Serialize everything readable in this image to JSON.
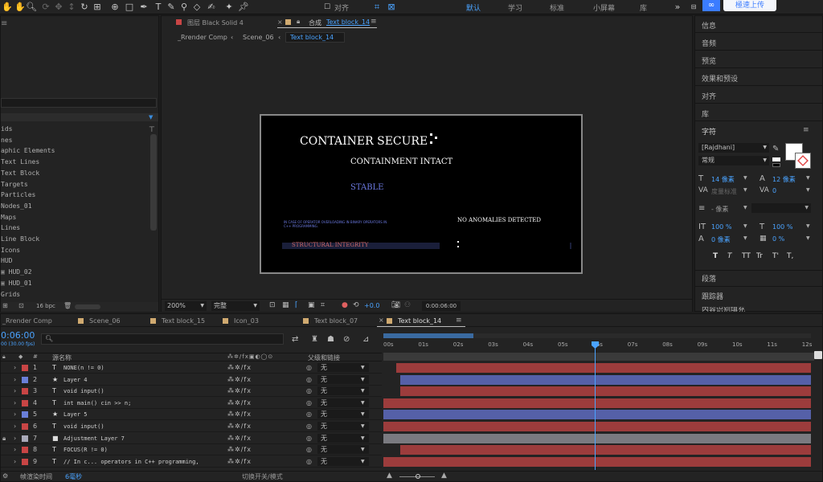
{
  "workspaces": [
    "默认",
    "学习",
    "标准",
    "小屏幕",
    "库"
  ],
  "toolbar": {
    "align_label": "对齐",
    "upload_label": "極速上传"
  },
  "comp_tabs": {
    "layer_tab": "图层 Black Solid 4",
    "comp_prefix": "合成",
    "comp_name": "Text block_14"
  },
  "breadcrumb": [
    "_Rrender Comp",
    "Scene_06",
    "Text block_14"
  ],
  "preview": {
    "line1": "CONTAINER SECURE",
    "line2": "CONTAINMENT INTACT",
    "line3": "STABLE",
    "small_text": "IN CASE OF OPERATOR OVERLOADING IN BINARY OPERATORS IN C++ PROGRAMMING.",
    "no_anomalies": "NO ANOMALIES DETECTED",
    "structural": "STRUCTURAL INTEGRITY"
  },
  "viewer_footer": {
    "zoom": "200%",
    "quality": "完整",
    "exposure": "+0.0",
    "timecode": "0:00:06:00"
  },
  "project_items": [
    "ids",
    "nes",
    "aphic Elements",
    "Text Lines",
    "Text Block",
    "Targets",
    "Particles",
    "Nodes_01",
    "Maps",
    "Lines",
    "Line Block",
    "Icons",
    "HUD",
    "HUD_02",
    "HUD_01",
    "Grids"
  ],
  "project_footer": {
    "bpc": "16 bpc"
  },
  "right_panel": {
    "items_top": [
      "信息",
      "音频",
      "预览",
      "效果和预设",
      "对齐",
      "库"
    ],
    "char_title": "字符",
    "font": "[Rajdhani]",
    "style": "常规",
    "size": "14 像素",
    "leading": "12 像素",
    "kerning": "度量标准",
    "tracking": "0",
    "stroke": "- 像素",
    "vscale": "100 %",
    "hscale": "100 %",
    "baseline": "0 像素",
    "tsume": "0 %",
    "type_buttons": [
      "T",
      "T",
      "TT",
      "Tr",
      "T'",
      "T,"
    ],
    "items_bottom": [
      "段落",
      "跟踪器",
      "内容识别填充"
    ]
  },
  "timeline": {
    "tabs": [
      "_Rrender Comp",
      "Scene_06",
      "Text block_15",
      "Icon_03",
      "Text block_07",
      "Text block_14"
    ],
    "timecode": "0:06:00",
    "timecode_sub": "00 (30.00 fps)",
    "col_source": "源名称",
    "col_parent": "父级和链接",
    "ruler": [
      "00s",
      "01s",
      "02s",
      "03s",
      "04s",
      "05s",
      "06s",
      "07s",
      "08s",
      "09s",
      "10s",
      "11s",
      "12s"
    ],
    "layers": [
      {
        "num": "1",
        "type": "T",
        "name": "NONE(n != 0)",
        "color": "#c84545",
        "parent": "无"
      },
      {
        "num": "2",
        "type": "★",
        "name": "Layer 4",
        "color": "#6a7fd8",
        "parent": "无"
      },
      {
        "num": "3",
        "type": "T",
        "name": "void input()",
        "color": "#c84545",
        "parent": "无"
      },
      {
        "num": "4",
        "type": "T",
        "name": "int main() cin >> n;",
        "color": "#c84545",
        "parent": "无"
      },
      {
        "num": "5",
        "type": "★",
        "name": "Layer 5",
        "color": "#6a7fd8",
        "parent": "无"
      },
      {
        "num": "6",
        "type": "T",
        "name": "void input()",
        "color": "#c84545",
        "parent": "无"
      },
      {
        "num": "7",
        "type": "■",
        "name": "Adjustment Layer 7",
        "color": "#a9a9b8",
        "parent": "无"
      },
      {
        "num": "8",
        "type": "T",
        "name": "FOCUS(R != 0)",
        "color": "#c84545",
        "parent": "无"
      },
      {
        "num": "9",
        "type": "T",
        "name": "// In c... operators in C++ programming,",
        "color": "#c84545",
        "parent": "无"
      }
    ],
    "footer_render_label": "帧渲染时间",
    "footer_render_value": "6毫秒",
    "footer_toggle": "切换开关/模式"
  }
}
